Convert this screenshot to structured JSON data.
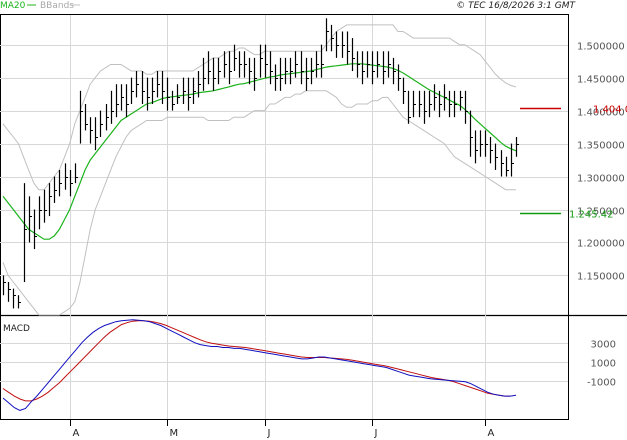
{
  "header": {
    "legend_ma": "MA20",
    "legend_bb": "BBands",
    "timestamp": "© TEC 16/8/2026 3:1 GMT"
  },
  "colors": {
    "price": "#000000",
    "ma20": "#1cb31c",
    "bbands": "#c0c0c0",
    "resistance": "#cc0000",
    "support": "#119911",
    "macd": "#1010c0",
    "signal": "#c01010",
    "grid": "#d8d8d8"
  },
  "chart_data": [
    {
      "type": "ohlc",
      "title": "",
      "y_ticks": [
        {
          "value": 1.15,
          "label": "1.150000"
        },
        {
          "value": 1.2,
          "label": "1.200000"
        },
        {
          "value": 1.25,
          "label": "1.250000"
        },
        {
          "value": 1.3,
          "label": "1.300000"
        },
        {
          "value": 1.35,
          "label": "1.350000"
        },
        {
          "value": 1.4,
          "label": "1.400000"
        },
        {
          "value": 1.45,
          "label": "1.450000"
        },
        {
          "value": 1.5,
          "label": "1.500000"
        }
      ],
      "ylim": [
        1.09,
        1.545
      ],
      "x_ticks": [
        {
          "index": 13,
          "label": "A"
        },
        {
          "index": 32,
          "label": "M"
        },
        {
          "index": 51,
          "label": "J"
        },
        {
          "index": 72,
          "label": "J"
        },
        {
          "index": 94,
          "label": "A"
        }
      ],
      "levels": [
        {
          "name": "resistance",
          "value": 1.404,
          "label": "1.404 0"
        },
        {
          "name": "support",
          "value": 1.2454,
          "label": "1.245.42"
        }
      ],
      "series": {
        "close": [
          1.14,
          1.13,
          1.12,
          1.11,
          1.22,
          1.24,
          1.21,
          1.25,
          1.25,
          1.27,
          1.28,
          1.29,
          1.3,
          1.29,
          1.3,
          1.4,
          1.38,
          1.37,
          1.36,
          1.38,
          1.39,
          1.4,
          1.41,
          1.42,
          1.41,
          1.43,
          1.44,
          1.43,
          1.42,
          1.43,
          1.44,
          1.43,
          1.42,
          1.41,
          1.42,
          1.43,
          1.42,
          1.43,
          1.44,
          1.45,
          1.46,
          1.45,
          1.46,
          1.47,
          1.46,
          1.48,
          1.47,
          1.47,
          1.46,
          1.45,
          1.48,
          1.47,
          1.46,
          1.45,
          1.45,
          1.46,
          1.46,
          1.47,
          1.46,
          1.45,
          1.46,
          1.47,
          1.47,
          1.52,
          1.51,
          1.5,
          1.5,
          1.49,
          1.48,
          1.47,
          1.46,
          1.47,
          1.46,
          1.47,
          1.46,
          1.47,
          1.46,
          1.45,
          1.43,
          1.39,
          1.41,
          1.41,
          1.4,
          1.41,
          1.42,
          1.41,
          1.42,
          1.41,
          1.41,
          1.42,
          1.4,
          1.36,
          1.34,
          1.35,
          1.35,
          1.34,
          1.33,
          1.32,
          1.31,
          1.32,
          1.35
        ],
        "high": [
          1.15,
          1.14,
          1.13,
          1.12,
          1.29,
          1.27,
          1.25,
          1.27,
          1.28,
          1.29,
          1.3,
          1.31,
          1.32,
          1.31,
          1.32,
          1.43,
          1.41,
          1.39,
          1.39,
          1.4,
          1.41,
          1.43,
          1.44,
          1.44,
          1.44,
          1.45,
          1.46,
          1.46,
          1.45,
          1.45,
          1.46,
          1.46,
          1.45,
          1.43,
          1.44,
          1.45,
          1.45,
          1.45,
          1.46,
          1.48,
          1.49,
          1.48,
          1.48,
          1.49,
          1.49,
          1.5,
          1.49,
          1.49,
          1.48,
          1.48,
          1.5,
          1.5,
          1.49,
          1.47,
          1.48,
          1.48,
          1.48,
          1.49,
          1.49,
          1.48,
          1.48,
          1.49,
          1.5,
          1.54,
          1.53,
          1.52,
          1.52,
          1.52,
          1.51,
          1.49,
          1.49,
          1.49,
          1.49,
          1.49,
          1.49,
          1.49,
          1.48,
          1.47,
          1.45,
          1.43,
          1.43,
          1.43,
          1.43,
          1.43,
          1.44,
          1.43,
          1.44,
          1.43,
          1.43,
          1.43,
          1.43,
          1.4,
          1.37,
          1.37,
          1.37,
          1.36,
          1.35,
          1.34,
          1.33,
          1.35,
          1.36
        ],
        "low": [
          1.12,
          1.11,
          1.1,
          1.1,
          1.14,
          1.2,
          1.19,
          1.22,
          1.23,
          1.24,
          1.26,
          1.27,
          1.28,
          1.27,
          1.29,
          1.35,
          1.37,
          1.35,
          1.34,
          1.36,
          1.37,
          1.38,
          1.39,
          1.4,
          1.39,
          1.41,
          1.42,
          1.41,
          1.4,
          1.41,
          1.42,
          1.41,
          1.4,
          1.4,
          1.41,
          1.41,
          1.4,
          1.41,
          1.42,
          1.43,
          1.44,
          1.43,
          1.44,
          1.45,
          1.44,
          1.46,
          1.45,
          1.45,
          1.44,
          1.43,
          1.45,
          1.45,
          1.44,
          1.43,
          1.43,
          1.44,
          1.44,
          1.45,
          1.44,
          1.43,
          1.44,
          1.45,
          1.45,
          1.49,
          1.49,
          1.48,
          1.48,
          1.47,
          1.46,
          1.45,
          1.44,
          1.45,
          1.44,
          1.45,
          1.44,
          1.45,
          1.44,
          1.43,
          1.41,
          1.38,
          1.39,
          1.39,
          1.38,
          1.39,
          1.4,
          1.39,
          1.4,
          1.39,
          1.39,
          1.4,
          1.38,
          1.33,
          1.32,
          1.33,
          1.33,
          1.32,
          1.31,
          1.3,
          1.3,
          1.3,
          1.33
        ],
        "ma20": [
          1.27,
          1.26,
          1.25,
          1.24,
          1.23,
          1.22,
          1.215,
          1.21,
          1.205,
          1.205,
          1.21,
          1.22,
          1.235,
          1.25,
          1.27,
          1.29,
          1.31,
          1.325,
          1.335,
          1.345,
          1.355,
          1.365,
          1.375,
          1.385,
          1.39,
          1.395,
          1.4,
          1.405,
          1.41,
          1.412,
          1.415,
          1.418,
          1.42,
          1.421,
          1.422,
          1.423,
          1.424,
          1.425,
          1.427,
          1.428,
          1.429,
          1.43,
          1.432,
          1.434,
          1.436,
          1.438,
          1.44,
          1.441,
          1.443,
          1.445,
          1.447,
          1.449,
          1.451,
          1.452,
          1.454,
          1.455,
          1.456,
          1.457,
          1.458,
          1.459,
          1.46,
          1.462,
          1.464,
          1.466,
          1.467,
          1.468,
          1.469,
          1.47,
          1.471,
          1.471,
          1.471,
          1.47,
          1.469,
          1.468,
          1.467,
          1.466,
          1.464,
          1.461,
          1.457,
          1.452,
          1.447,
          1.442,
          1.437,
          1.432,
          1.428,
          1.424,
          1.42,
          1.416,
          1.412,
          1.408,
          1.402,
          1.395,
          1.387,
          1.38,
          1.373,
          1.366,
          1.359,
          1.352,
          1.346,
          1.342,
          1.339
        ],
        "bb_upper": [
          1.38,
          1.37,
          1.36,
          1.35,
          1.33,
          1.31,
          1.29,
          1.28,
          1.28,
          1.29,
          1.3,
          1.31,
          1.33,
          1.35,
          1.38,
          1.4,
          1.42,
          1.44,
          1.45,
          1.46,
          1.465,
          1.47,
          1.47,
          1.47,
          1.465,
          1.46,
          1.46,
          1.46,
          1.455,
          1.455,
          1.46,
          1.46,
          1.46,
          1.46,
          1.46,
          1.46,
          1.46,
          1.46,
          1.465,
          1.47,
          1.475,
          1.48,
          1.48,
          1.485,
          1.49,
          1.49,
          1.495,
          1.495,
          1.49,
          1.485,
          1.485,
          1.49,
          1.49,
          1.49,
          1.49,
          1.49,
          1.49,
          1.49,
          1.49,
          1.49,
          1.49,
          1.49,
          1.49,
          1.5,
          1.51,
          1.52,
          1.525,
          1.53,
          1.53,
          1.53,
          1.53,
          1.53,
          1.53,
          1.53,
          1.53,
          1.53,
          1.53,
          1.52,
          1.52,
          1.515,
          1.51,
          1.51,
          1.51,
          1.51,
          1.51,
          1.51,
          1.51,
          1.51,
          1.505,
          1.5,
          1.5,
          1.495,
          1.49,
          1.485,
          1.475,
          1.465,
          1.455,
          1.448,
          1.442,
          1.438,
          1.436
        ],
        "bb_lower": [
          1.17,
          1.15,
          1.14,
          1.13,
          1.12,
          1.11,
          1.1,
          1.09,
          1.09,
          1.09,
          1.09,
          1.09,
          1.095,
          1.1,
          1.11,
          1.14,
          1.18,
          1.22,
          1.25,
          1.27,
          1.29,
          1.31,
          1.33,
          1.345,
          1.36,
          1.37,
          1.375,
          1.38,
          1.385,
          1.385,
          1.385,
          1.385,
          1.39,
          1.39,
          1.39,
          1.39,
          1.39,
          1.39,
          1.39,
          1.39,
          1.385,
          1.385,
          1.385,
          1.385,
          1.385,
          1.39,
          1.39,
          1.39,
          1.395,
          1.4,
          1.4,
          1.4,
          1.41,
          1.41,
          1.415,
          1.42,
          1.42,
          1.425,
          1.425,
          1.43,
          1.43,
          1.43,
          1.43,
          1.43,
          1.425,
          1.42,
          1.41,
          1.405,
          1.405,
          1.41,
          1.41,
          1.41,
          1.415,
          1.415,
          1.42,
          1.42,
          1.41,
          1.4,
          1.39,
          1.385,
          1.38,
          1.375,
          1.37,
          1.365,
          1.36,
          1.355,
          1.35,
          1.34,
          1.33,
          1.325,
          1.32,
          1.315,
          1.31,
          1.305,
          1.3,
          1.295,
          1.29,
          1.285,
          1.28,
          1.28,
          1.28
        ]
      }
    },
    {
      "type": "line",
      "title": "MACD",
      "y_ticks": [
        {
          "value": 3000,
          "label": "3000"
        },
        {
          "value": 1000,
          "label": "1000"
        },
        {
          "value": -1000,
          "label": "-1000"
        }
      ],
      "ylim": [
        -5000,
        5800
      ],
      "series": {
        "macd": [
          -2800,
          -3300,
          -3800,
          -4100,
          -3900,
          -3200,
          -2600,
          -1900,
          -1200,
          -500,
          200,
          900,
          1600,
          2300,
          3000,
          3600,
          4100,
          4500,
          4800,
          5000,
          5200,
          5300,
          5350,
          5400,
          5350,
          5300,
          5200,
          5000,
          4800,
          4500,
          4200,
          3900,
          3600,
          3300,
          3000,
          2800,
          2700,
          2600,
          2600,
          2500,
          2500,
          2400,
          2400,
          2300,
          2200,
          2100,
          2000,
          1900,
          1800,
          1700,
          1600,
          1500,
          1400,
          1300,
          1300,
          1400,
          1500,
          1500,
          1400,
          1300,
          1200,
          1100,
          1000,
          900,
          800,
          700,
          600,
          500,
          400,
          200,
          0,
          -200,
          -400,
          -500,
          -600,
          -700,
          -800,
          -850,
          -900,
          -950,
          -1000,
          -1050,
          -1100,
          -1300,
          -1600,
          -1900,
          -2200,
          -2400,
          -2500,
          -2600,
          -2600,
          -2500
        ],
        "signal": [
          -1800,
          -2200,
          -2600,
          -2900,
          -3100,
          -3100,
          -2900,
          -2600,
          -2200,
          -1700,
          -1200,
          -600,
          0,
          600,
          1200,
          1800,
          2400,
          3000,
          3600,
          4100,
          4500,
          4900,
          5100,
          5250,
          5300,
          5300,
          5250,
          5150,
          5000,
          4800,
          4550,
          4300,
          4050,
          3800,
          3550,
          3300,
          3100,
          2950,
          2850,
          2750,
          2650,
          2600,
          2550,
          2500,
          2400,
          2300,
          2200,
          2100,
          2000,
          1900,
          1800,
          1700,
          1600,
          1500,
          1450,
          1450,
          1450,
          1450,
          1400,
          1350,
          1300,
          1250,
          1150,
          1050,
          950,
          850,
          750,
          650,
          550,
          400,
          250,
          100,
          -50,
          -200,
          -350,
          -500,
          -650,
          -750,
          -850,
          -950,
          -1100,
          -1300,
          -1500,
          -1700,
          -1900,
          -2100,
          -2300,
          -2400,
          -2500,
          -2600,
          -2600
        ]
      }
    }
  ]
}
